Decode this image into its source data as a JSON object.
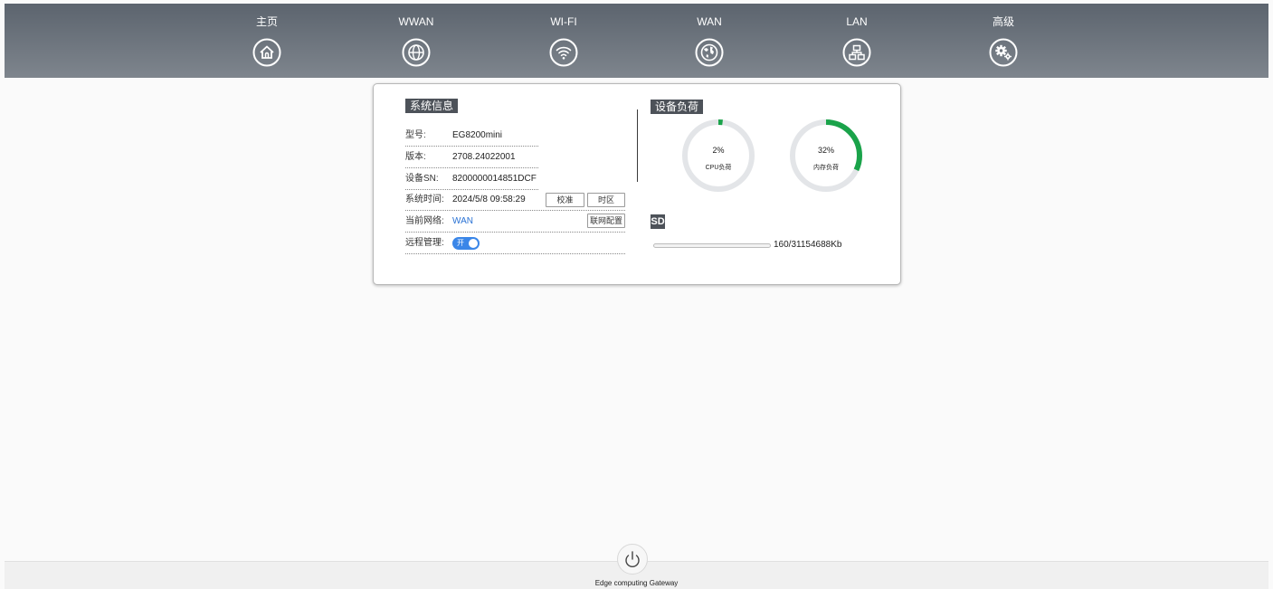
{
  "nav": {
    "items": [
      {
        "label": "主页",
        "icon": "home-icon"
      },
      {
        "label": "WWAN",
        "icon": "globe-icon"
      },
      {
        "label": "WI-FI",
        "icon": "wifi-icon"
      },
      {
        "label": "WAN",
        "icon": "earth-icon"
      },
      {
        "label": "LAN",
        "icon": "network-icon"
      },
      {
        "label": "高级",
        "icon": "gears-icon"
      }
    ]
  },
  "system_info": {
    "title": "系统信息",
    "model_label": "型号:",
    "model_value": "EG8200mini",
    "version_label": "版本:",
    "version_value": "2708.24022001",
    "sn_label": "设备SN:",
    "sn_value": "8200000014851DCF",
    "time_label": "系统时间:",
    "time_value": "2024/5/8 09:58:29",
    "calibrate_button": "校准",
    "timezone_button": "时区",
    "network_label": "当前网络:",
    "network_value": "WAN",
    "network_config_button": "联网配置",
    "remote_label": "远程管理:",
    "remote_toggle_text": "开",
    "remote_enabled": true
  },
  "device_load": {
    "title": "设备负荷",
    "cpu_percent": "2%",
    "cpu_label": "CPU负荷",
    "cpu_value": 2,
    "mem_percent": "32%",
    "mem_label": "内存负荷",
    "mem_value": 32
  },
  "sd": {
    "badge": "SD",
    "usage_text": "160/31154688Kb",
    "used_fraction": 5.1e-06
  },
  "footer": {
    "text": "Edge computing Gateway"
  },
  "colors": {
    "nav_top": "#5c646e",
    "nav_bottom": "#7e858d",
    "accent_blue": "#3a86e8",
    "gauge_green": "#1aa34a",
    "gauge_track": "#e3e5e8",
    "title_bg": "#4d5259"
  }
}
